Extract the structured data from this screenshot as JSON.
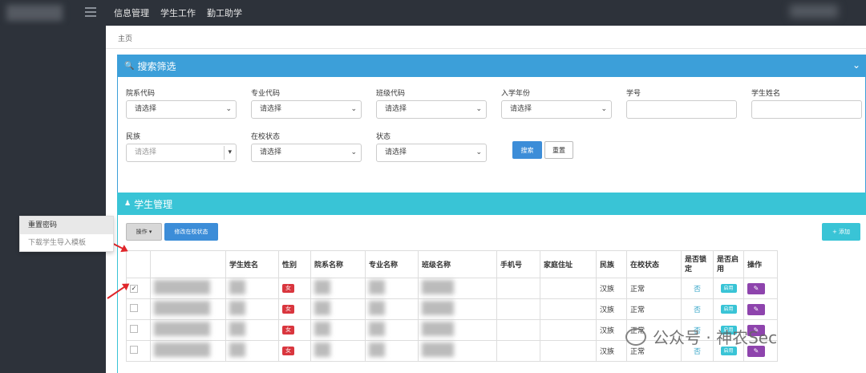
{
  "topnav": [
    "信息管理",
    "学生工作",
    "勤工助学"
  ],
  "breadcrumb": "主页",
  "search_box": {
    "title": "搜索筛选",
    "fields": [
      {
        "label": "院系代码",
        "value": "请选择"
      },
      {
        "label": "专业代码",
        "value": "请选择"
      },
      {
        "label": "班级代码",
        "value": "请选择"
      },
      {
        "label": "入学年份",
        "value": "请选择"
      },
      {
        "label": "学号",
        "value": ""
      },
      {
        "label": "学生姓名",
        "value": ""
      },
      {
        "label": "民族",
        "value": "请选择"
      },
      {
        "label": "在校状态",
        "value": "请选择"
      },
      {
        "label": "状态",
        "value": "请选择"
      }
    ],
    "search_button": "搜索",
    "reset_button": "重置"
  },
  "students_box": {
    "title": "学生管理",
    "op_button": "操作 ▾",
    "status_button": "修改在校状态",
    "add_button": "+ 添加",
    "dropdown": [
      "重置密码",
      "下载学生导入模板"
    ],
    "columns": [
      "",
      "",
      "学生姓名",
      "性别",
      "院系名称",
      "专业名称",
      "班级名称",
      "手机号",
      "家庭住址",
      "民族",
      "在校状态",
      "是否锁定",
      "是否启用",
      "操作"
    ],
    "rows": [
      {
        "gender": "女",
        "nation": "汉族",
        "status": "正常",
        "locked": "否",
        "enabled": "启用"
      },
      {
        "gender": "女",
        "nation": "汉族",
        "status": "正常",
        "locked": "否",
        "enabled": "启用"
      },
      {
        "gender": "女",
        "nation": "汉族",
        "status": "正常",
        "locked": "否",
        "enabled": "启用"
      },
      {
        "gender": "女",
        "nation": "汉族",
        "status": "正常",
        "locked": "否",
        "enabled": "启用"
      }
    ]
  },
  "watermark": "公众号 · 神农Sec"
}
